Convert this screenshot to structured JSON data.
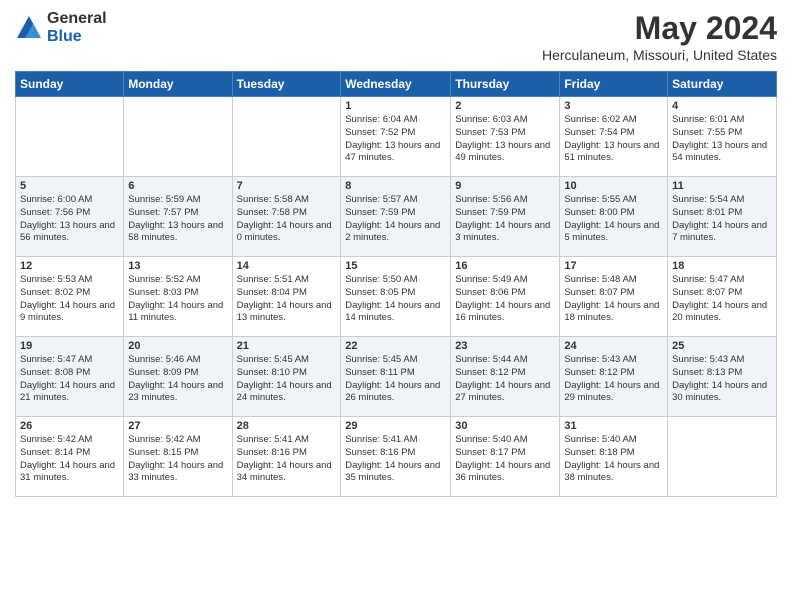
{
  "logo": {
    "general": "General",
    "blue": "Blue"
  },
  "title": "May 2024",
  "location": "Herculaneum, Missouri, United States",
  "weekdays": [
    "Sunday",
    "Monday",
    "Tuesday",
    "Wednesday",
    "Thursday",
    "Friday",
    "Saturday"
  ],
  "weeks": [
    [
      {
        "day": "",
        "info": ""
      },
      {
        "day": "",
        "info": ""
      },
      {
        "day": "",
        "info": ""
      },
      {
        "day": "1",
        "info": "Sunrise: 6:04 AM\nSunset: 7:52 PM\nDaylight: 13 hours\nand 47 minutes."
      },
      {
        "day": "2",
        "info": "Sunrise: 6:03 AM\nSunset: 7:53 PM\nDaylight: 13 hours\nand 49 minutes."
      },
      {
        "day": "3",
        "info": "Sunrise: 6:02 AM\nSunset: 7:54 PM\nDaylight: 13 hours\nand 51 minutes."
      },
      {
        "day": "4",
        "info": "Sunrise: 6:01 AM\nSunset: 7:55 PM\nDaylight: 13 hours\nand 54 minutes."
      }
    ],
    [
      {
        "day": "5",
        "info": "Sunrise: 6:00 AM\nSunset: 7:56 PM\nDaylight: 13 hours\nand 56 minutes."
      },
      {
        "day": "6",
        "info": "Sunrise: 5:59 AM\nSunset: 7:57 PM\nDaylight: 13 hours\nand 58 minutes."
      },
      {
        "day": "7",
        "info": "Sunrise: 5:58 AM\nSunset: 7:58 PM\nDaylight: 14 hours\nand 0 minutes."
      },
      {
        "day": "8",
        "info": "Sunrise: 5:57 AM\nSunset: 7:59 PM\nDaylight: 14 hours\nand 2 minutes."
      },
      {
        "day": "9",
        "info": "Sunrise: 5:56 AM\nSunset: 7:59 PM\nDaylight: 14 hours\nand 3 minutes."
      },
      {
        "day": "10",
        "info": "Sunrise: 5:55 AM\nSunset: 8:00 PM\nDaylight: 14 hours\nand 5 minutes."
      },
      {
        "day": "11",
        "info": "Sunrise: 5:54 AM\nSunset: 8:01 PM\nDaylight: 14 hours\nand 7 minutes."
      }
    ],
    [
      {
        "day": "12",
        "info": "Sunrise: 5:53 AM\nSunset: 8:02 PM\nDaylight: 14 hours\nand 9 minutes."
      },
      {
        "day": "13",
        "info": "Sunrise: 5:52 AM\nSunset: 8:03 PM\nDaylight: 14 hours\nand 11 minutes."
      },
      {
        "day": "14",
        "info": "Sunrise: 5:51 AM\nSunset: 8:04 PM\nDaylight: 14 hours\nand 13 minutes."
      },
      {
        "day": "15",
        "info": "Sunrise: 5:50 AM\nSunset: 8:05 PM\nDaylight: 14 hours\nand 14 minutes."
      },
      {
        "day": "16",
        "info": "Sunrise: 5:49 AM\nSunset: 8:06 PM\nDaylight: 14 hours\nand 16 minutes."
      },
      {
        "day": "17",
        "info": "Sunrise: 5:48 AM\nSunset: 8:07 PM\nDaylight: 14 hours\nand 18 minutes."
      },
      {
        "day": "18",
        "info": "Sunrise: 5:47 AM\nSunset: 8:07 PM\nDaylight: 14 hours\nand 20 minutes."
      }
    ],
    [
      {
        "day": "19",
        "info": "Sunrise: 5:47 AM\nSunset: 8:08 PM\nDaylight: 14 hours\nand 21 minutes."
      },
      {
        "day": "20",
        "info": "Sunrise: 5:46 AM\nSunset: 8:09 PM\nDaylight: 14 hours\nand 23 minutes."
      },
      {
        "day": "21",
        "info": "Sunrise: 5:45 AM\nSunset: 8:10 PM\nDaylight: 14 hours\nand 24 minutes."
      },
      {
        "day": "22",
        "info": "Sunrise: 5:45 AM\nSunset: 8:11 PM\nDaylight: 14 hours\nand 26 minutes."
      },
      {
        "day": "23",
        "info": "Sunrise: 5:44 AM\nSunset: 8:12 PM\nDaylight: 14 hours\nand 27 minutes."
      },
      {
        "day": "24",
        "info": "Sunrise: 5:43 AM\nSunset: 8:12 PM\nDaylight: 14 hours\nand 29 minutes."
      },
      {
        "day": "25",
        "info": "Sunrise: 5:43 AM\nSunset: 8:13 PM\nDaylight: 14 hours\nand 30 minutes."
      }
    ],
    [
      {
        "day": "26",
        "info": "Sunrise: 5:42 AM\nSunset: 8:14 PM\nDaylight: 14 hours\nand 31 minutes."
      },
      {
        "day": "27",
        "info": "Sunrise: 5:42 AM\nSunset: 8:15 PM\nDaylight: 14 hours\nand 33 minutes."
      },
      {
        "day": "28",
        "info": "Sunrise: 5:41 AM\nSunset: 8:16 PM\nDaylight: 14 hours\nand 34 minutes."
      },
      {
        "day": "29",
        "info": "Sunrise: 5:41 AM\nSunset: 8:16 PM\nDaylight: 14 hours\nand 35 minutes."
      },
      {
        "day": "30",
        "info": "Sunrise: 5:40 AM\nSunset: 8:17 PM\nDaylight: 14 hours\nand 36 minutes."
      },
      {
        "day": "31",
        "info": "Sunrise: 5:40 AM\nSunset: 8:18 PM\nDaylight: 14 hours\nand 38 minutes."
      },
      {
        "day": "",
        "info": ""
      }
    ]
  ]
}
